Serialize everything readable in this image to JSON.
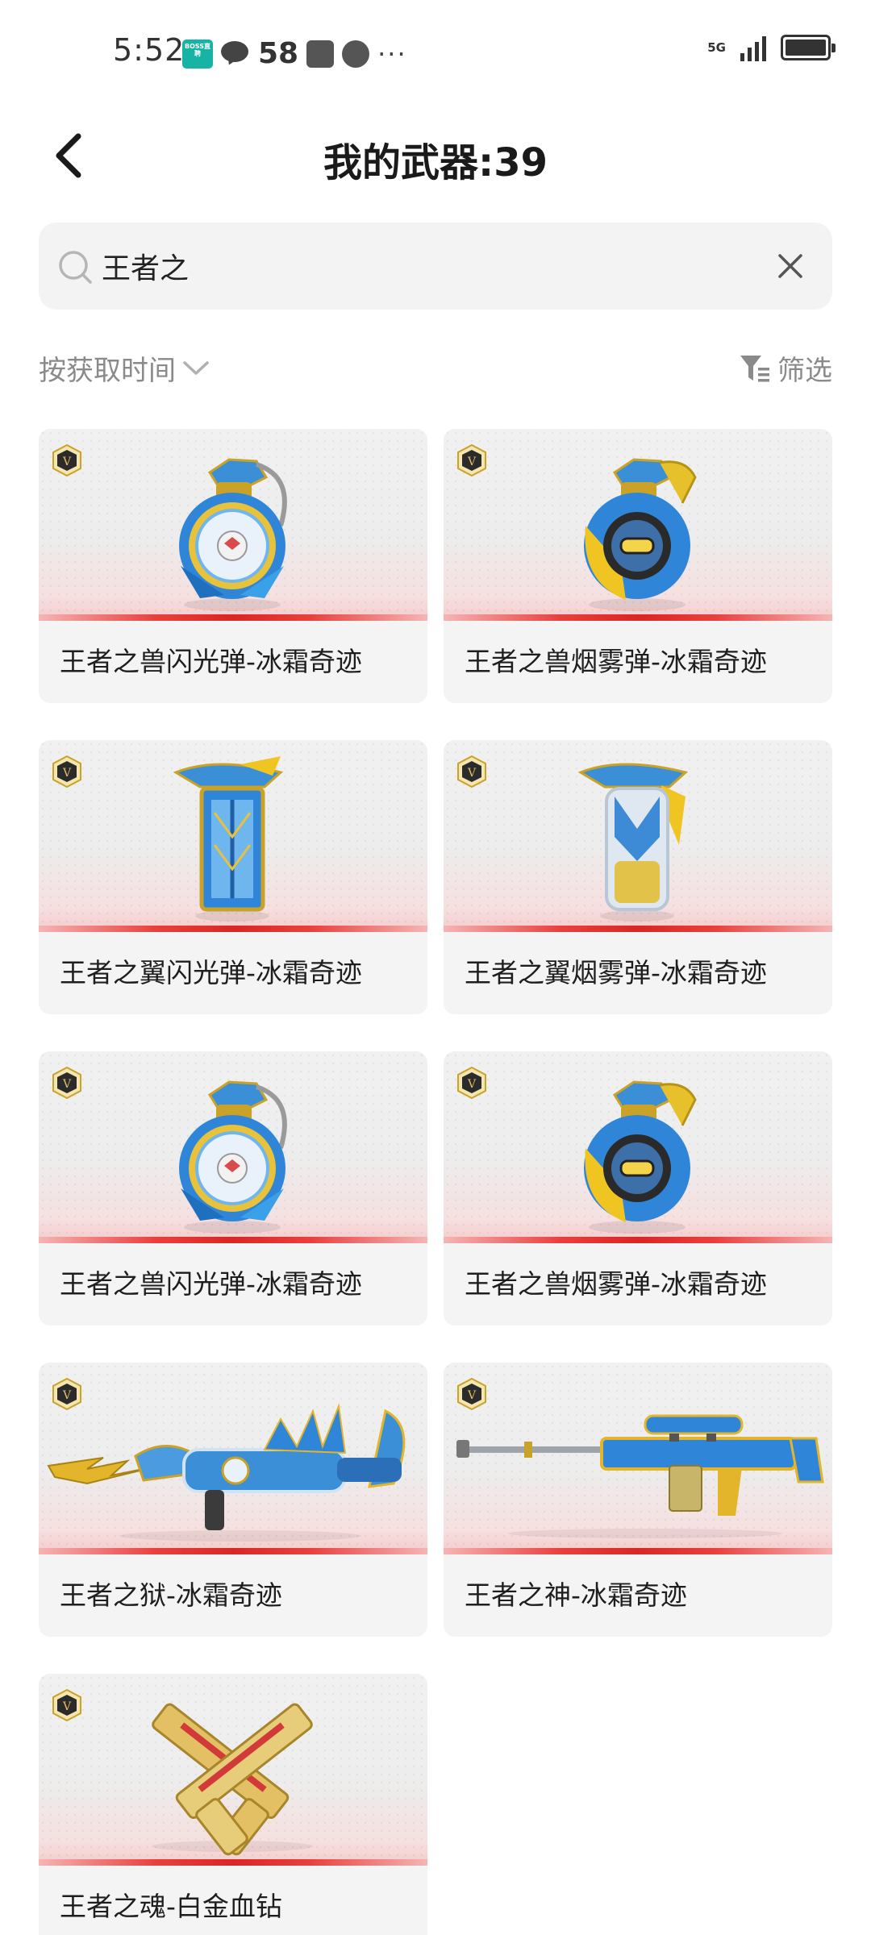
{
  "status_bar": {
    "time": "5:52",
    "boss_app": "BOSS直聘",
    "notification_count": "58",
    "more": "···",
    "network": "5G"
  },
  "header": {
    "title": "我的武器:39"
  },
  "search": {
    "value": "王者之"
  },
  "toolbar": {
    "sort_label": "按获取时间",
    "filter_label": "筛选"
  },
  "weapons": [
    {
      "name": "王者之兽闪光弹-冰霜奇迹",
      "kind": "grenade-blue",
      "badge": "V"
    },
    {
      "name": "王者之兽烟雾弹-冰霜奇迹",
      "kind": "grenade-gold",
      "badge": "V"
    },
    {
      "name": "王者之翼闪光弹-冰霜奇迹",
      "kind": "canister-blue",
      "badge": "V"
    },
    {
      "name": "王者之翼烟雾弹-冰霜奇迹",
      "kind": "canister-white",
      "badge": "V"
    },
    {
      "name": "王者之兽闪光弹-冰霜奇迹",
      "kind": "grenade-blue",
      "badge": "V"
    },
    {
      "name": "王者之兽烟雾弹-冰霜奇迹",
      "kind": "grenade-gold",
      "badge": "V"
    },
    {
      "name": "王者之狱-冰霜奇迹",
      "kind": "rifle-dragon",
      "badge": "V"
    },
    {
      "name": "王者之神-冰霜奇迹",
      "kind": "sniper",
      "badge": "V"
    },
    {
      "name": "王者之魂-白金血钻",
      "kind": "pistols-gold",
      "badge": "V"
    }
  ],
  "colors": {
    "accent_red": "#d92626",
    "card_bg": "#f4f4f4",
    "muted_text": "#8a8a8a",
    "badge_gold": "#c9a227"
  }
}
